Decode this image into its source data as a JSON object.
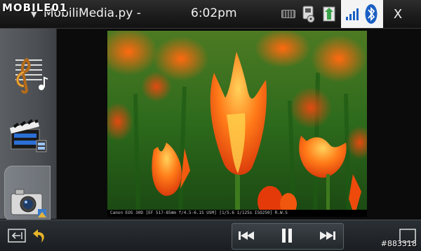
{
  "overlay": {
    "site_logo": "MOBILE01",
    "watermark": "#883318"
  },
  "header": {
    "menu_arrow": "▼",
    "title": "MobiliMedia.py -",
    "time": "6:02pm",
    "close_label": "X",
    "icons": [
      "keyboard-icon",
      "media-status-icon",
      "transfer-status-icon",
      "signal-icon",
      "bluetooth-icon"
    ]
  },
  "sidebar": {
    "items": [
      {
        "name": "music",
        "icon": "music-note-icon"
      },
      {
        "name": "video",
        "icon": "clapperboard-icon"
      },
      {
        "name": "images",
        "icon": "camera-icon",
        "active": true
      }
    ]
  },
  "viewer": {
    "caption": "Canon EOS 30D [EF 517-85mm f/4.5-6.1S USM] [1/5.6 1/125s ISO250]          R.W.S"
  },
  "toolbar": {
    "icons": [
      "exit-fullscreen-icon",
      "back-arrow-icon",
      "previous-icon",
      "pause-icon",
      "next-icon",
      "window-icon"
    ]
  },
  "colors": {
    "accent_blue": "#1b5fc4",
    "tray_bg": "#f4f4f4",
    "bar_bg": "#1c1c1c"
  }
}
